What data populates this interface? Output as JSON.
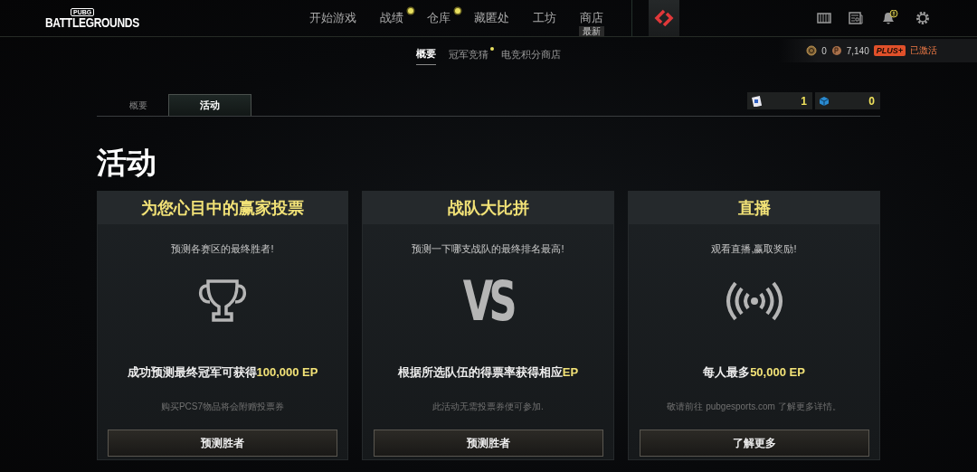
{
  "header": {
    "logo_top": "PUBG",
    "logo_bottom": "BATTLEGROUNDS",
    "nav": [
      {
        "label": "开始游戏",
        "dot": false
      },
      {
        "label": "战绩",
        "dot": true
      },
      {
        "label": "仓库",
        "dot": true
      },
      {
        "label": "藏匿处",
        "dot": false
      },
      {
        "label": "工坊",
        "dot": false
      },
      {
        "label": "商店",
        "dot": false,
        "tag": "最新"
      }
    ],
    "bell_alert": true
  },
  "subnav": [
    {
      "label": "概要",
      "selected": true,
      "dot": false
    },
    {
      "label": "冠军竞猜",
      "selected": false,
      "dot": true
    },
    {
      "label": "电竞积分商店",
      "selected": false,
      "dot": false
    }
  ],
  "wallet": {
    "g_coin": "0",
    "bp": "7,140",
    "plus_badge": "PLUS+",
    "plus_status": "已激活"
  },
  "tabs": [
    {
      "label": "概要",
      "selected": false
    },
    {
      "label": "活动",
      "selected": true
    }
  ],
  "counters": [
    {
      "kind": "ticket",
      "value": "1"
    },
    {
      "kind": "cube",
      "value": "0"
    }
  ],
  "page_title": "活动",
  "cards": [
    {
      "kind": "trophy",
      "title": "为您心目中的赢家投票",
      "subtitle": "预测各赛区的最终胜者!",
      "reward": "成功预测最终冠军可获得**100,000 EP**",
      "note": "购买PCS7物品将会附赠投票券",
      "button": "预测胜者"
    },
    {
      "kind": "vs",
      "emblem": "VS",
      "title": "战队大比拼",
      "subtitle": "预测一下哪支战队的最终排名最高!",
      "reward": "根据所选队伍的得票率获得相应**EP**",
      "note": "此活动无需投票券便可参加.",
      "button": "预测胜者"
    },
    {
      "kind": "broadcast",
      "title": "直播",
      "subtitle": "观看直播,赢取奖励!",
      "reward": "每人最多**50,000 EP**",
      "note": "敬请前往 pubgesports.com 了解更多详情。",
      "button": "了解更多"
    }
  ]
}
